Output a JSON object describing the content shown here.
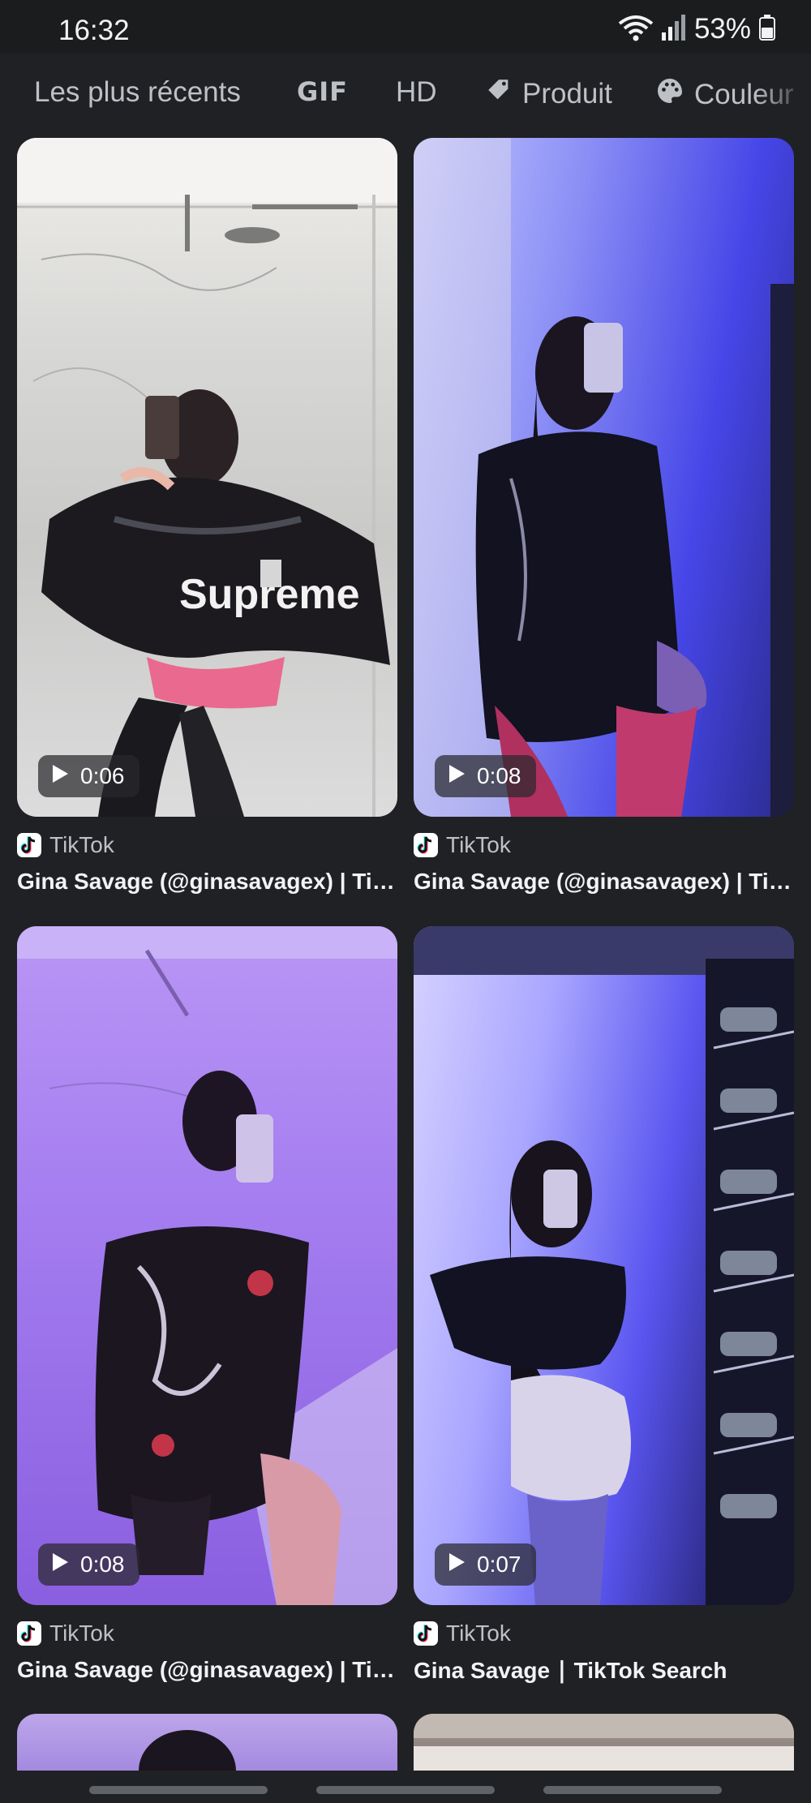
{
  "status_bar": {
    "time": "16:32",
    "battery": "53%"
  },
  "filters": [
    {
      "label": "Les plus récents"
    },
    {
      "label": "GIF"
    },
    {
      "label": "HD"
    },
    {
      "label": "Produit",
      "icon": "tag-icon"
    },
    {
      "label": "Couleur",
      "icon": "palette-icon"
    }
  ],
  "results": [
    {
      "duration": "0:06",
      "source": "TikTok",
      "title": "Gina Savage (@ginasavagex) | TikTok"
    },
    {
      "duration": "0:08",
      "source": "TikTok",
      "title": "Gina Savage (@ginasavagex) | TikTok"
    },
    {
      "duration": "0:08",
      "source": "TikTok",
      "title": "Gina Savage (@ginasavagex) | TikTok"
    },
    {
      "duration": "0:07",
      "source": "TikTok",
      "title": "Gina Savage ∣ TikTok Search"
    }
  ],
  "colors": {
    "background": "#202124",
    "text_primary": "#f1f3f4",
    "text_secondary": "#bdc1c6"
  }
}
